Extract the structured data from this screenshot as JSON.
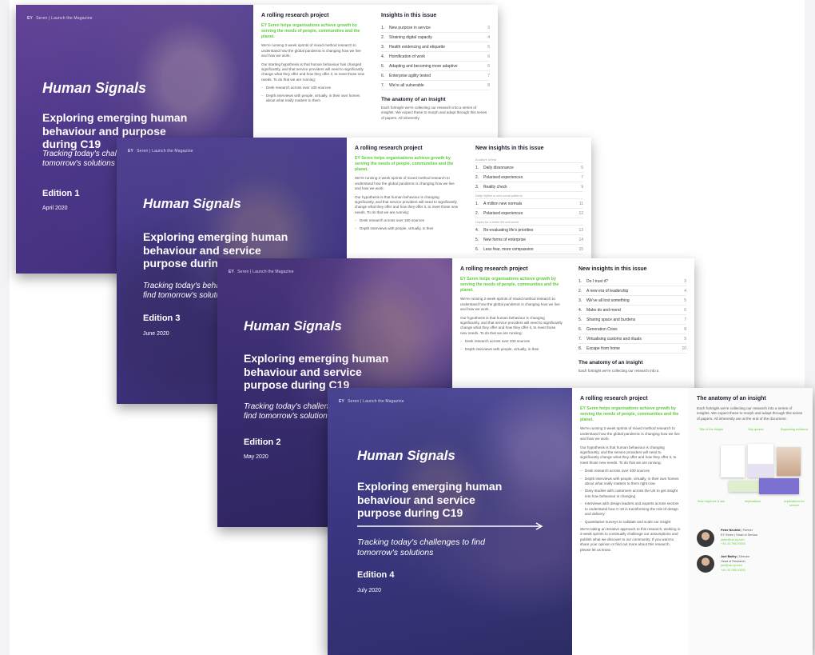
{
  "brand": {
    "logo": "EY",
    "tagline": "Seren | Launch the Magazine"
  },
  "editions": [
    {
      "cover_title": "Human Signals",
      "cover_subtitle": "Exploring emerging human behaviour and purpose during C19",
      "tracking": "Tracking today's challenges to find tomorrow's solutions",
      "edition": "Edition 1",
      "date": "April 2020",
      "rolling_title": "A rolling research project",
      "lead": "EY Seren helps organisations achieve growth by serving the needs of people, communities and the planet.",
      "para1": "We're running 2-week sprints of mixed method research to understand how the global pandemic is changing how we live and how we work.",
      "para2": "Our starting hypothesis is that human behaviour has changed significantly, and that service providers will need to significantly change what they offer and how they offer it, to meet those new needs. To do that we are running:",
      "bullets": [
        "Desk research across over 100 sources",
        "Depth interviews with people, virtually, in their own homes about what really matters to them"
      ],
      "toc_title": "Insights in this issue",
      "toc": [
        {
          "n": "1.",
          "t": "New purpose in service",
          "p": "3"
        },
        {
          "n": "2.",
          "t": "Straining digital capacity",
          "p": "4"
        },
        {
          "n": "3.",
          "t": "Health evidencing and etiquette",
          "p": "5"
        },
        {
          "n": "4.",
          "t": "Homification of work",
          "p": "6"
        },
        {
          "n": "5.",
          "t": "Adapting and becoming more adaptive",
          "p": "6"
        },
        {
          "n": "6.",
          "t": "Enterprise agility tested",
          "p": "7"
        },
        {
          "n": "7.",
          "t": "We're all vulnerable",
          "p": "8"
        }
      ],
      "anatomy_title": "The anatomy of an insight",
      "anatomy_text": "Each fortnight we're collecting our research into a series of insights. We expect these to morph and adapt through this series of papers. All inherently"
    },
    {
      "cover_title": "Human Signals",
      "cover_subtitle": "Exploring emerging human behaviour and service purpose during C19",
      "tracking": "Tracking today's behaviours to find tomorrow's solutions",
      "edition": "Edition 3",
      "date": "June 2020",
      "rolling_title": "A rolling research project",
      "lead": "EY Seren helps organisations achieve growth by serving the needs of people, communities and the planet.",
      "para1": "We're running 2-week sprints of mixed method research to understand how the global pandemic is changing how we live and how we work.",
      "para2": "Our hypothesis is that human behaviour is changing significantly, and that service providers will need to significantly change what they offer and how they offer it, to meet those new needs. To do that we are running:",
      "bullets": [
        "Desk research across over 150 sources",
        "Depth interviews with people, virtually, in their"
      ],
      "toc_title": "New insights in this issue",
      "toc_groups": [
        {
          "label": "A culture of fear",
          "items": [
            {
              "n": "1.",
              "t": "Daily dissonance",
              "p": "5"
            },
            {
              "n": "2.",
              "t": "Polarised experiences",
              "p": "7"
            },
            {
              "n": "3.",
              "t": "Reality check",
              "p": "9"
            }
          ]
        },
        {
          "label": "Daily rhythm in new social patterns",
          "items": [
            {
              "n": "1.",
              "t": "A million new normals",
              "p": "11"
            },
            {
              "n": "2.",
              "t": "Polarised experiences",
              "p": "12"
            }
          ]
        },
        {
          "label": "Hopes for a better life and world",
          "items": [
            {
              "n": "4.",
              "t": "Re-evaluating life's priorities",
              "p": "13"
            },
            {
              "n": "5.",
              "t": "New forms of enterprise",
              "p": "14"
            },
            {
              "n": "6.",
              "t": "Less fear, more compassion",
              "p": "15"
            }
          ]
        }
      ]
    },
    {
      "cover_title": "Human Signals",
      "cover_subtitle": "Exploring emerging human behaviour and service purpose during C19",
      "tracking": "Tracking today's challenges to find tomorrow's solutions",
      "edition": "Edition 2",
      "date": "May 2020",
      "rolling_title": "A rolling research project",
      "lead": "EY Seren helps organisations achieve growth by serving the needs of people, communities and the planet.",
      "para1": "We're running 2-week sprints of mixed method research to understand how the global pandemic is changing how we live and how we work.",
      "para2": "Our hypothesis is that human behaviour is changing significantly, and that service providers will need to significantly change what they offer and how they offer it, to meet those new needs. To do that we are running:",
      "bullets": [
        "Desk research across over 200 sources",
        "Depth interviews with people, virtually, in their"
      ],
      "toc_title": "New insights in this issue",
      "toc": [
        {
          "n": "1.",
          "t": "Do I trust it?",
          "p": "3"
        },
        {
          "n": "2.",
          "t": "A new era of leadership",
          "p": "4"
        },
        {
          "n": "3.",
          "t": "We've all lost something",
          "p": "5"
        },
        {
          "n": "4.",
          "t": "Make do and mend",
          "p": "6"
        },
        {
          "n": "5.",
          "t": "Sharing space and burdens",
          "p": "7"
        },
        {
          "n": "6.",
          "t": "Generation Crisis",
          "p": "8"
        },
        {
          "n": "7.",
          "t": "Virtualising customs and rituals",
          "p": "9"
        },
        {
          "n": "8.",
          "t": "Escape from home",
          "p": "10"
        }
      ],
      "anatomy_title": "The anatomy of an insight",
      "anatomy_text": "Each fortnight we're collecting our research into a"
    },
    {
      "cover_title": "Human Signals",
      "cover_subtitle": "Exploring emerging human behaviour and service purpose during C19",
      "tracking": "Tracking today's challenges to find tomorrow's solutions",
      "edition": "Edition 4",
      "date": "July 2020",
      "rolling_title": "A rolling research project",
      "lead": "EY Seren helps organisations achieve growth by serving the needs of people, communities and the planet.",
      "para1": "We're running 2-week sprints of mixed method research to understand how the global pandemic is changing how we live and how we work.",
      "para2": "Our hypothesis is that human behaviour is changing significantly, and the service providers will need to significantly change what they offer and how they offer it, to meet those new needs. To do that we are running:",
      "bullets": [
        "Desk research across over 400 sources",
        "Depth interviews with people, virtually, in their own homes about what really matters to them right now",
        "Diary studies with customers across the UK to get insight into how behaviour is changing",
        "Interviews with design leaders and experts across sectors to understand how C-19 is transforming the role of design and delivery",
        "Quantitative surveys to validate and scale our insight"
      ],
      "para3": "We're taking an iterative approach to this research, working in 2-week sprints to continually challenge our assumptions and publish what we discover to our community. If you want to share your opinion or find out more about this research, please let us know.",
      "anatomy_title": "The anatomy of an insight",
      "anatomy_text": "Each fortnight we're collecting our research into a series of insights. We expect these to morph and adapt through this series of papers. All inherently are at the end of the document.",
      "diagram_labels": [
        "Title of the insight",
        "Key quotes",
        "Supporting evidence",
        "How might we & ask",
        "Implications",
        "Implications for service"
      ],
      "people": [
        {
          "name": "Peter Neufeld",
          "role": "Partner",
          "line1": "EY Seren | Head of Service",
          "line2": "peter@uk.ey.com",
          "line3": "+44 20 7951 0000"
        },
        {
          "name": "Joel Bailey",
          "role": "Director",
          "line1": "Head of Research",
          "line2": "joel@uk.ey.com",
          "line3": "+44 20 7951 0000"
        }
      ]
    }
  ]
}
